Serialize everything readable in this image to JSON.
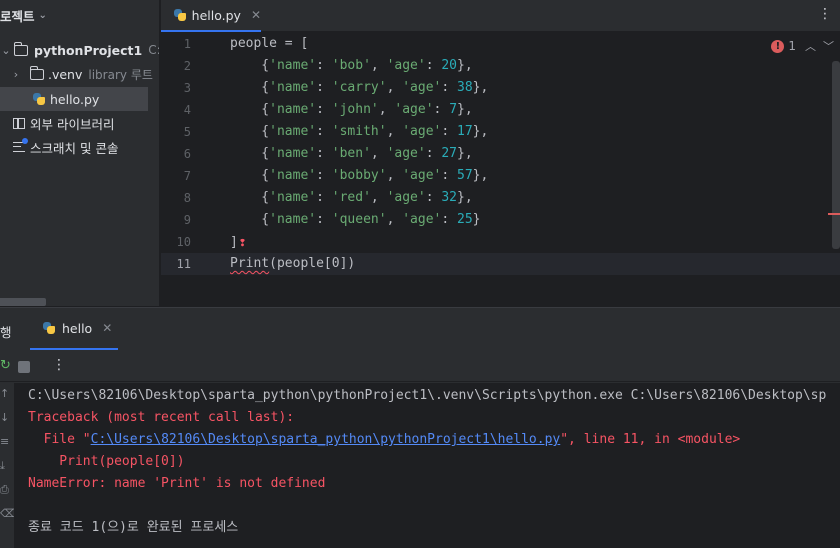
{
  "project_panel": {
    "title": "로젝트",
    "items": [
      {
        "label": "pythonProject1",
        "detail": "C:₩Use"
      },
      {
        "label": ".venv",
        "detail": "library 루트"
      },
      {
        "label": "hello.py"
      },
      {
        "label": "외부 라이브러리"
      },
      {
        "label": "스크래치 및 콘솔"
      }
    ]
  },
  "editor": {
    "tab_label": "hello.py",
    "problems_count": "1",
    "line_numbers": [
      "1",
      "2",
      "3",
      "4",
      "5",
      "6",
      "7",
      "8",
      "9",
      "10",
      "11"
    ],
    "people_list": [
      {
        "name": "bob",
        "age": "20"
      },
      {
        "name": "carry",
        "age": "38"
      },
      {
        "name": "john",
        "age": "7"
      },
      {
        "name": "smith",
        "age": "17"
      },
      {
        "name": "ben",
        "age": "27"
      },
      {
        "name": "bobby",
        "age": "57"
      },
      {
        "name": "red",
        "age": "32"
      },
      {
        "name": "queen",
        "age": "25"
      }
    ],
    "code": {
      "line1": "people = [",
      "key_name": "'name'",
      "key_age": "'age'",
      "line10": "]",
      "line11_func": "Print",
      "line11_rest": "(people[0])"
    }
  },
  "run_window": {
    "label": "행",
    "tab_label": "hello",
    "console": {
      "command": "C:\\Users\\82106\\Desktop\\sparta_python\\pythonProject1\\.venv\\Scripts\\python.exe C:\\Users\\82106\\Desktop\\sp",
      "traceback": "Traceback (most recent call last):",
      "file_prefix": "  File \"",
      "file_path": "C:\\Users\\82106\\Desktop\\sparta_python\\pythonProject1\\hello.py",
      "file_suffix": "\", line 11, in <module>",
      "code_line": "    Print(people[0])",
      "error": "NameError: name 'Print' is not defined",
      "exit": "종료 코드 1(으)로 완료된 프로세스"
    }
  }
}
